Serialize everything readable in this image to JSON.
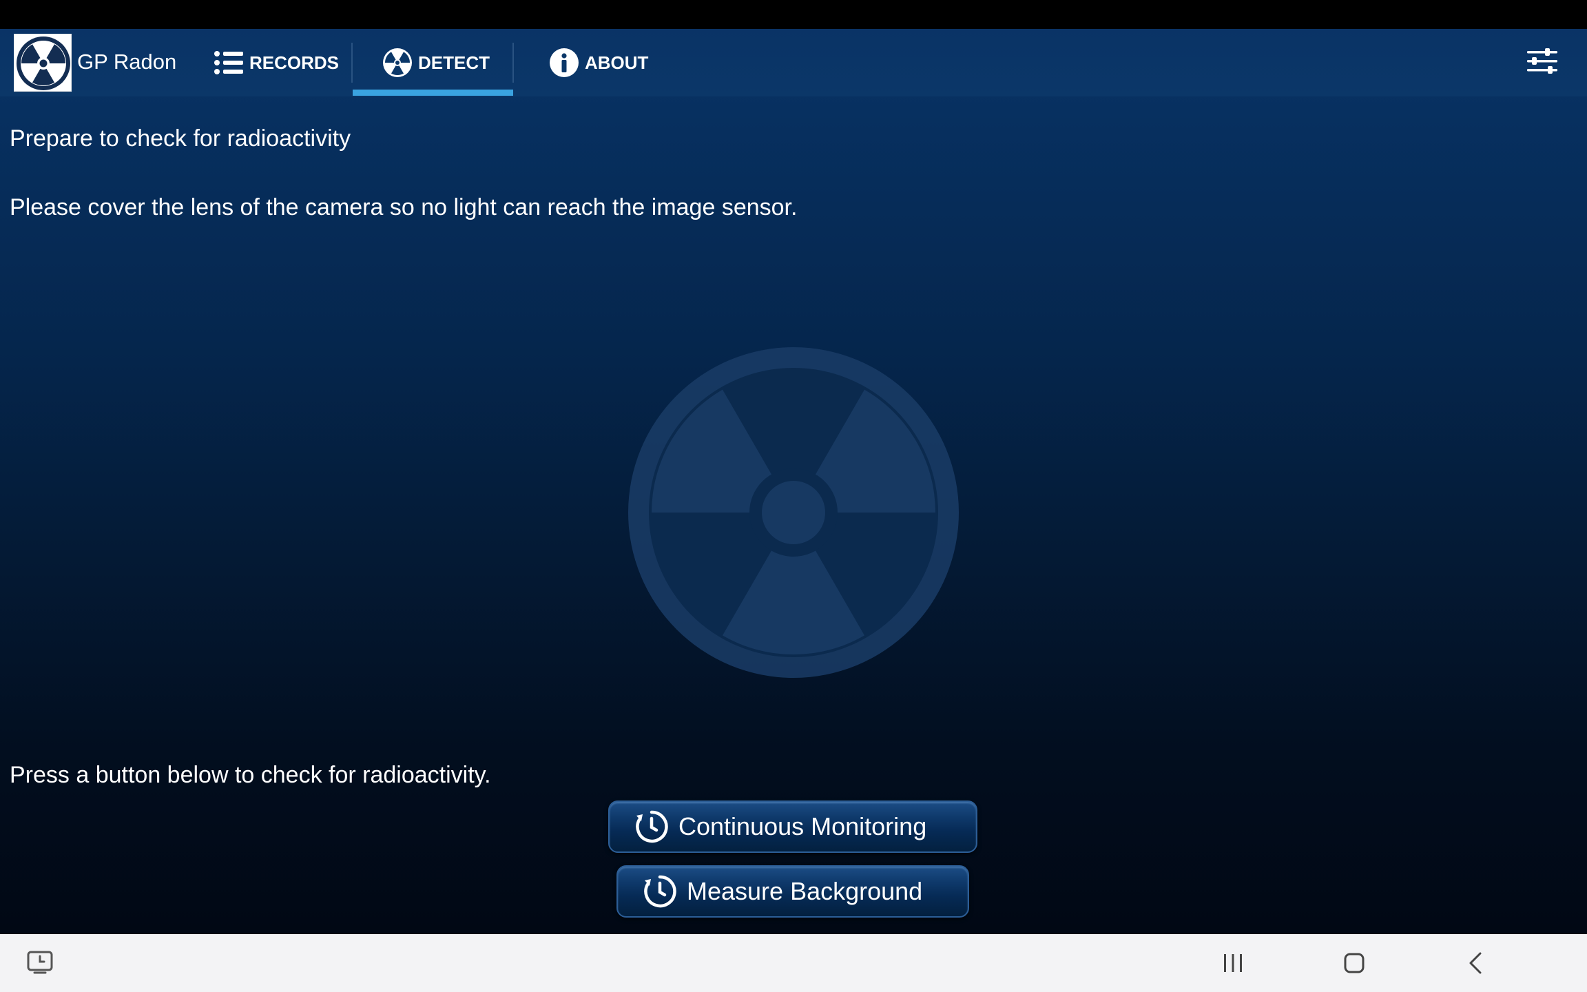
{
  "app": {
    "title": "GP Radon",
    "logo_icon": "radiation-logo-icon"
  },
  "tabs": [
    {
      "label": "RECORDS",
      "icon": "list-icon",
      "selected": false
    },
    {
      "label": "DETECT",
      "icon": "radiation-icon",
      "selected": true
    },
    {
      "label": "ABOUT",
      "icon": "info-icon",
      "selected": false
    }
  ],
  "menu": {
    "icon": "settings-sliders-icon"
  },
  "main": {
    "title": "Prepare to check for radioactivity",
    "instruction": "Please cover the lens of the camera so no light can reach the image sensor.",
    "prompt": "Press a button below to check for radioactivity.",
    "background_icon": "radiation-symbol-icon"
  },
  "buttons": {
    "continuous": {
      "label": "Continuous Monitoring",
      "icon": "timer-icon"
    },
    "background": {
      "label": "Measure Background",
      "icon": "timer-icon"
    }
  },
  "system_nav": {
    "items": [
      "screenshot-icon",
      "recent-apps-icon",
      "home-icon",
      "back-icon"
    ]
  },
  "colors": {
    "accent": "#3aa3e0",
    "topbar": "#0b3768",
    "text": "#ffffff"
  }
}
